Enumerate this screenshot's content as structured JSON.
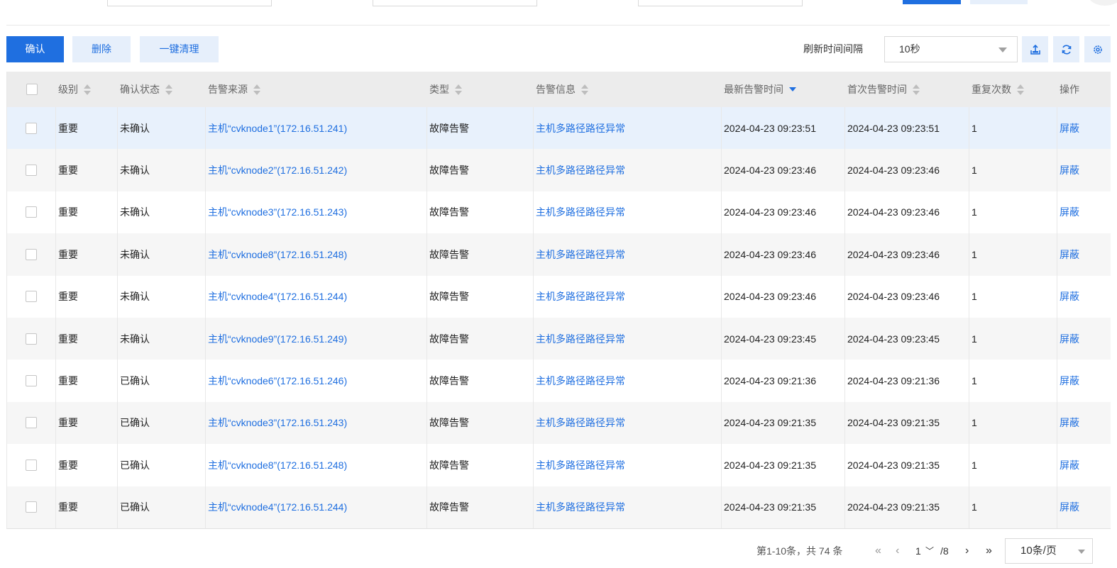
{
  "toolbar": {
    "confirm": "确认",
    "delete": "删除",
    "clear_all": "一键清理",
    "refresh_label": "刷新时间间隔",
    "refresh_value": "10秒"
  },
  "table": {
    "headers": [
      "级别",
      "确认状态",
      "告警来源",
      "类型",
      "告警信息",
      "最新告警时间",
      "首次告警时间",
      "重复次数",
      "操作"
    ],
    "rows": [
      {
        "level": "重要",
        "status": "未确认",
        "source": "主机“cvknode1”(172.16.51.241)",
        "type": "故障告警",
        "info": "主机多路径路径异常",
        "latest": "2024-04-23 09:23:51",
        "first": "2024-04-23 09:23:51",
        "repeat": "1",
        "action": "屏蔽"
      },
      {
        "level": "重要",
        "status": "未确认",
        "source": "主机“cvknode2”(172.16.51.242)",
        "type": "故障告警",
        "info": "主机多路径路径异常",
        "latest": "2024-04-23 09:23:46",
        "first": "2024-04-23 09:23:46",
        "repeat": "1",
        "action": "屏蔽"
      },
      {
        "level": "重要",
        "status": "未确认",
        "source": "主机“cvknode3”(172.16.51.243)",
        "type": "故障告警",
        "info": "主机多路径路径异常",
        "latest": "2024-04-23 09:23:46",
        "first": "2024-04-23 09:23:46",
        "repeat": "1",
        "action": "屏蔽"
      },
      {
        "level": "重要",
        "status": "未确认",
        "source": "主机“cvknode8”(172.16.51.248)",
        "type": "故障告警",
        "info": "主机多路径路径异常",
        "latest": "2024-04-23 09:23:46",
        "first": "2024-04-23 09:23:46",
        "repeat": "1",
        "action": "屏蔽"
      },
      {
        "level": "重要",
        "status": "未确认",
        "source": "主机“cvknode4”(172.16.51.244)",
        "type": "故障告警",
        "info": "主机多路径路径异常",
        "latest": "2024-04-23 09:23:46",
        "first": "2024-04-23 09:23:46",
        "repeat": "1",
        "action": "屏蔽"
      },
      {
        "level": "重要",
        "status": "未确认",
        "source": "主机“cvknode9”(172.16.51.249)",
        "type": "故障告警",
        "info": "主机多路径路径异常",
        "latest": "2024-04-23 09:23:45",
        "first": "2024-04-23 09:23:45",
        "repeat": "1",
        "action": "屏蔽"
      },
      {
        "level": "重要",
        "status": "已确认",
        "source": "主机“cvknode6”(172.16.51.246)",
        "type": "故障告警",
        "info": "主机多路径路径异常",
        "latest": "2024-04-23 09:21:36",
        "first": "2024-04-23 09:21:36",
        "repeat": "1",
        "action": "屏蔽"
      },
      {
        "level": "重要",
        "status": "已确认",
        "source": "主机“cvknode3”(172.16.51.243)",
        "type": "故障告警",
        "info": "主机多路径路径异常",
        "latest": "2024-04-23 09:21:35",
        "first": "2024-04-23 09:21:35",
        "repeat": "1",
        "action": "屏蔽"
      },
      {
        "level": "重要",
        "status": "已确认",
        "source": "主机“cvknode8”(172.16.51.248)",
        "type": "故障告警",
        "info": "主机多路径路径异常",
        "latest": "2024-04-23 09:21:35",
        "first": "2024-04-23 09:21:35",
        "repeat": "1",
        "action": "屏蔽"
      },
      {
        "level": "重要",
        "status": "已确认",
        "source": "主机“cvknode4”(172.16.51.244)",
        "type": "故障告警",
        "info": "主机多路径路径异常",
        "latest": "2024-04-23 09:21:35",
        "first": "2024-04-23 09:21:35",
        "repeat": "1",
        "action": "屏蔽"
      }
    ]
  },
  "pagination": {
    "total_text": "第1-10条，共 74 条",
    "current_page": "1",
    "total_pages": "/8",
    "page_size": "10条/页"
  },
  "icons": {
    "export": "export-icon",
    "refresh": "refresh-icon",
    "settings": "gear-icon"
  },
  "colors": {
    "primary": "#1f6fe0",
    "light_button": "#e6effb",
    "header_bg": "#ececec",
    "highlight_row": "#e8f1fc"
  }
}
